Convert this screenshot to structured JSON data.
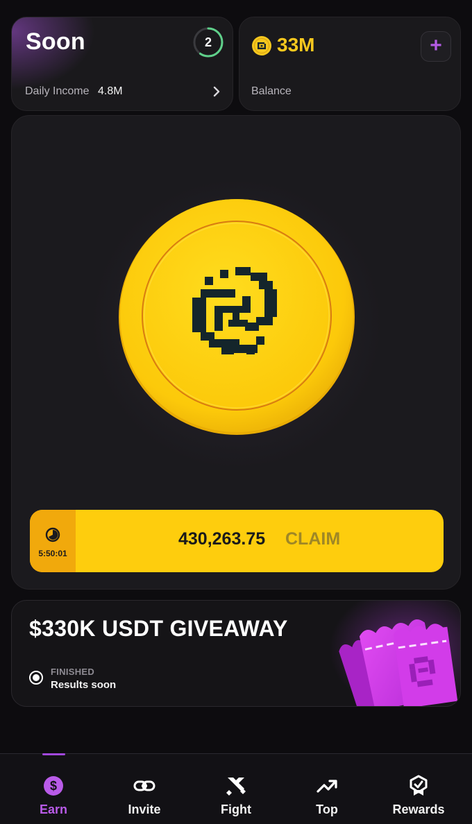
{
  "level_card": {
    "title": "Soon",
    "level": "2",
    "income_label": "Daily Income",
    "income_value": "4.8M"
  },
  "balance_card": {
    "value": "33M",
    "label": "Balance",
    "add_label": "+"
  },
  "claim": {
    "timer": "5:50:01",
    "amount": "430,263.75",
    "label": "CLAIM"
  },
  "giveaway": {
    "title": "$330K USDT GIVEAWAY",
    "status": "FINISHED",
    "subtitle": "Results soon"
  },
  "nav": {
    "items": [
      {
        "label": "Earn",
        "icon": "dollar-icon",
        "active": true
      },
      {
        "label": "Invite",
        "icon": "link-icon",
        "active": false
      },
      {
        "label": "Fight",
        "icon": "swords-icon",
        "active": false
      },
      {
        "label": "Top",
        "icon": "trending-up-icon",
        "active": false
      },
      {
        "label": "Rewards",
        "icon": "badge-icon",
        "active": false
      }
    ]
  },
  "colors": {
    "accent": "#b95be8",
    "coin": "#fecd0d",
    "timer_bg": "#f1a90c",
    "background": "#0d0c0f",
    "ring": "#5fd08a"
  }
}
